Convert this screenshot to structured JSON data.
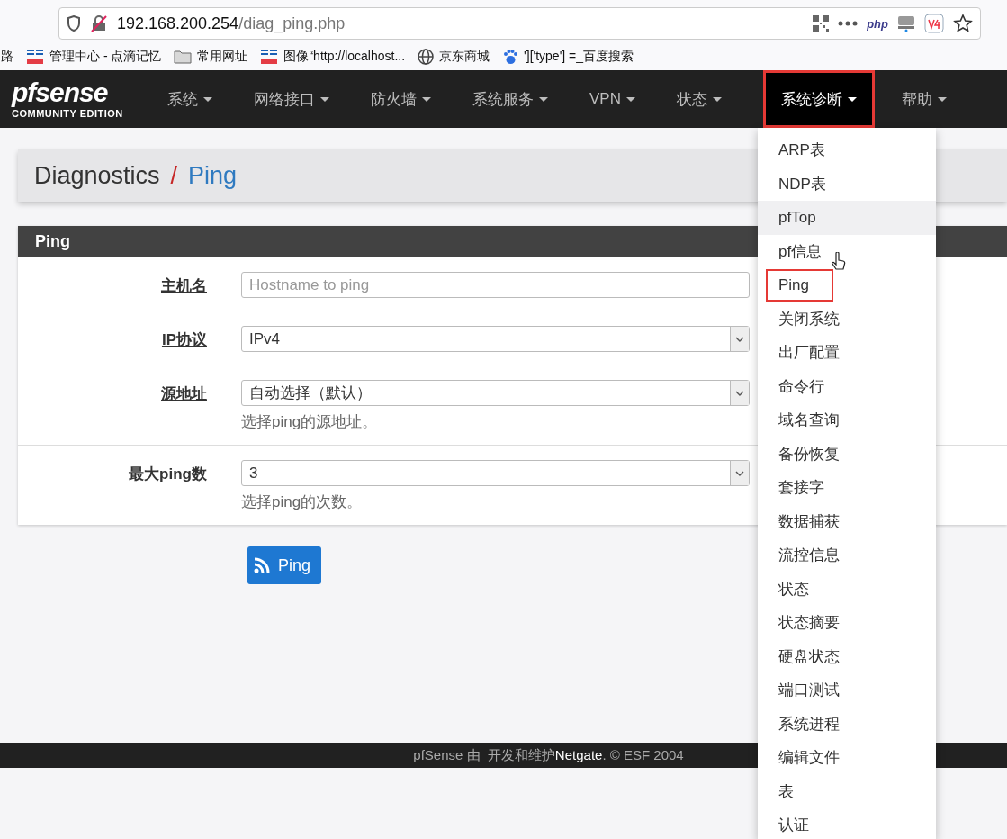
{
  "browser": {
    "url_host": "192.168.200.254",
    "url_path": "/diag_ping.php",
    "toolbar_php": "php",
    "bookmarks": [
      {
        "kind": "plain",
        "label": "路"
      },
      {
        "kind": "cms",
        "label": "管理中心 - 点滴记忆"
      },
      {
        "kind": "folder",
        "label": "常用网址"
      },
      {
        "kind": "cms",
        "label": "图像“http://localhost..."
      },
      {
        "kind": "web",
        "label": "京东商城"
      },
      {
        "kind": "search",
        "label": "']['type'] =_百度搜索"
      }
    ]
  },
  "logo": {
    "name": "pfsense",
    "edition": "COMMUNITY EDITION"
  },
  "nav": [
    {
      "label": "系统",
      "selected": false
    },
    {
      "label": "网络接口",
      "selected": false
    },
    {
      "label": "防火墙",
      "selected": false
    },
    {
      "label": "系统服务",
      "selected": false
    },
    {
      "label": "VPN",
      "selected": false
    },
    {
      "label": "状态",
      "selected": false
    },
    {
      "label": "系统诊断",
      "selected": true
    },
    {
      "label": "帮助",
      "selected": false
    }
  ],
  "breadcrumb": {
    "section": "Diagnostics",
    "separator": "/",
    "page": "Ping"
  },
  "panel": {
    "title": "Ping",
    "fields": [
      {
        "kind": "text",
        "label": "主机名",
        "underline": true,
        "placeholder": "Hostname to ping"
      },
      {
        "kind": "select",
        "label": "IP协议",
        "underline": true,
        "value": "IPv4"
      },
      {
        "kind": "select",
        "label": "源地址",
        "underline": true,
        "value": "自动选择（默认）",
        "help": "选择ping的源地址。"
      },
      {
        "kind": "select",
        "label": "最大ping数",
        "underline": false,
        "value": "3",
        "help": "选择ping的次数。"
      }
    ]
  },
  "ping_button": "Ping",
  "menu": [
    {
      "label": "ARP表",
      "hovered": false,
      "outlined": false
    },
    {
      "label": "NDP表",
      "hovered": false,
      "outlined": false
    },
    {
      "label": "pfTop",
      "hovered": true,
      "outlined": false
    },
    {
      "label": "pf信息",
      "hovered": false,
      "outlined": false
    },
    {
      "label": "Ping",
      "hovered": false,
      "outlined": true
    },
    {
      "label": "关闭系统",
      "hovered": false,
      "outlined": false
    },
    {
      "label": "出厂配置",
      "hovered": false,
      "outlined": false
    },
    {
      "label": "命令行",
      "hovered": false,
      "outlined": false
    },
    {
      "label": "域名查询",
      "hovered": false,
      "outlined": false
    },
    {
      "label": "备份恢复",
      "hovered": false,
      "outlined": false
    },
    {
      "label": "套接字",
      "hovered": false,
      "outlined": false
    },
    {
      "label": "数据捕获",
      "hovered": false,
      "outlined": false
    },
    {
      "label": "流控信息",
      "hovered": false,
      "outlined": false
    },
    {
      "label": "状态",
      "hovered": false,
      "outlined": false
    },
    {
      "label": "状态摘要",
      "hovered": false,
      "outlined": false
    },
    {
      "label": "硬盘状态",
      "hovered": false,
      "outlined": false
    },
    {
      "label": "端口测试",
      "hovered": false,
      "outlined": false
    },
    {
      "label": "系统进程",
      "hovered": false,
      "outlined": false
    },
    {
      "label": "编辑文件",
      "hovered": false,
      "outlined": false
    },
    {
      "label": "表",
      "hovered": false,
      "outlined": false
    },
    {
      "label": "认证",
      "hovered": false,
      "outlined": false
    }
  ],
  "footer": {
    "text": "pfSense 由  开发和维护",
    "link": "Netgate",
    "copyright": ". © ESF 2004"
  }
}
